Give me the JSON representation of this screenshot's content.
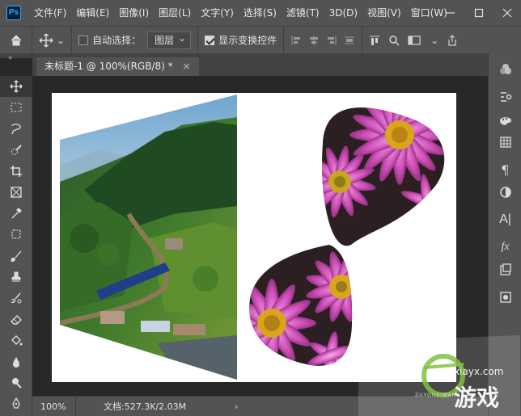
{
  "app": {
    "logo": "Ps"
  },
  "menu": [
    "文件(F)",
    "编辑(E)",
    "图像(I)",
    "图层(L)",
    "文字(Y)",
    "选择(S)",
    "滤镜(T)",
    "3D(D)",
    "视图(V)",
    "窗口(W)"
  ],
  "window_controls": [
    "minimize-icon",
    "maximize-icon",
    "close-icon"
  ],
  "options": {
    "auto_select_label": "自动选择：",
    "auto_select_checked": false,
    "auto_select_target": "图层",
    "show_transform_label": "显示变换控件",
    "show_transform_checked": true
  },
  "document_tab": {
    "title": "未标题-1 @ 100%(RGB/8) *",
    "close": "×"
  },
  "tools": [
    "move-tool-icon",
    "marquee-tool-icon",
    "lasso-tool-icon",
    "quick-select-tool-icon",
    "crop-tool-icon",
    "frame-tool-icon",
    "eyedropper-tool-icon",
    "healing-brush-tool-icon",
    "brush-tool-icon",
    "clone-stamp-tool-icon",
    "history-brush-tool-icon",
    "eraser-tool-icon",
    "paint-bucket-tool-icon",
    "blur-tool-icon",
    "dodge-tool-icon",
    "pen-tool-icon"
  ],
  "right_panel": [
    "color-panel-icon",
    "adjustments-panel-icon",
    "swatches-panel-icon",
    "grid-panel-icon",
    "paragraph-panel-icon",
    "adjustment-layer-icon",
    "character-panel-icon",
    "fx-panel-icon",
    "layers-panel-icon",
    "channels-panel-icon"
  ],
  "status": {
    "zoom": "100%",
    "doc_size": "文档:527.3K/2.03M",
    "arrow": "›"
  },
  "watermark": {
    "text": "游戏",
    "subtext": "xiayx.com",
    "brand": "ZIIYOUXIWANG"
  },
  "colors": {
    "chrome": "#535353",
    "workspace": "#282828",
    "canvas": "#ffffff",
    "accent": "#31a8ff"
  }
}
